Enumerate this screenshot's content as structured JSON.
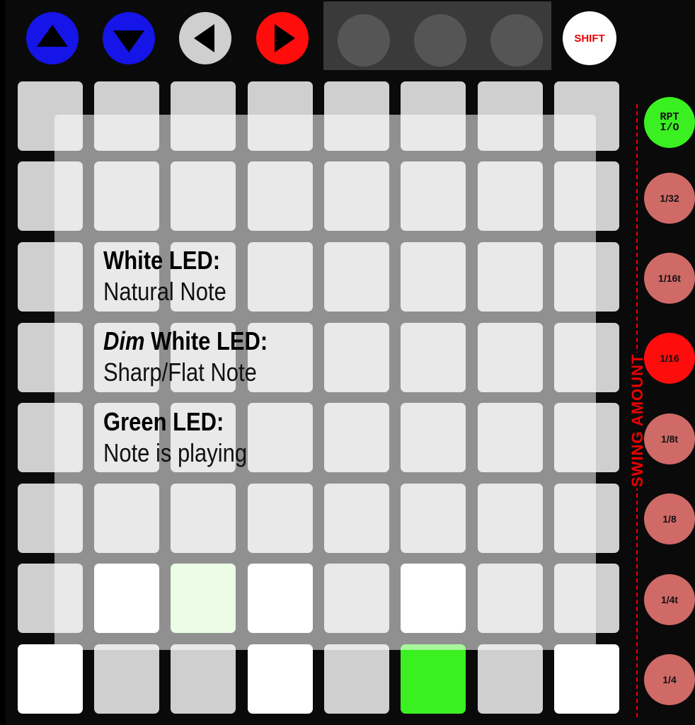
{
  "top_buttons": [
    {
      "name": "up-arrow-button",
      "icon": "triangle-up-icon",
      "color": "#1515e8"
    },
    {
      "name": "down-arrow-button",
      "icon": "triangle-down-icon",
      "color": "#1515e8"
    },
    {
      "name": "left-arrow-button",
      "icon": "triangle-left-icon",
      "color": "#cfcfcf"
    },
    {
      "name": "right-arrow-button",
      "icon": "triangle-right-icon",
      "color": "#ff0d0d"
    }
  ],
  "shift_label": "SHIFT",
  "legend": {
    "white_head": "White LED:",
    "white_desc": "Natural Note",
    "dim_word": "Dim",
    "dim_rest": " White LED:",
    "dim_desc": "Sharp/Flat Note",
    "green_head": "Green LED:",
    "green_desc": "Note is playing"
  },
  "grid": {
    "colors": {
      "off": "#cfcfcf",
      "white": "#ffffff",
      "green_dim": "#d2fbc8",
      "green": "#3bf021"
    },
    "rows": [
      [
        "off",
        "off",
        "off",
        "off",
        "off",
        "off",
        "off",
        "off"
      ],
      [
        "off",
        "off",
        "off",
        "off",
        "off",
        "off",
        "off",
        "off"
      ],
      [
        "off",
        "off",
        "off",
        "off",
        "off",
        "off",
        "off",
        "off"
      ],
      [
        "off",
        "off",
        "off",
        "off",
        "off",
        "off",
        "off",
        "off"
      ],
      [
        "off",
        "off",
        "off",
        "off",
        "off",
        "off",
        "off",
        "off"
      ],
      [
        "off",
        "off",
        "off",
        "off",
        "off",
        "off",
        "off",
        "off"
      ],
      [
        "off",
        "white",
        "green_dim",
        "white",
        "off",
        "white",
        "off",
        "off"
      ],
      [
        "white",
        "off",
        "off",
        "white",
        "off",
        "green",
        "off",
        "white"
      ]
    ]
  },
  "side_buttons": {
    "rpt_line1": "RPT",
    "rpt_line2": "I/O",
    "rates": [
      "1/32",
      "1/16t",
      "1/16",
      "1/8t",
      "1/8",
      "1/4t",
      "1/4"
    ],
    "active_rate": "1/16"
  },
  "swing_label": "SWING AMOUNT"
}
